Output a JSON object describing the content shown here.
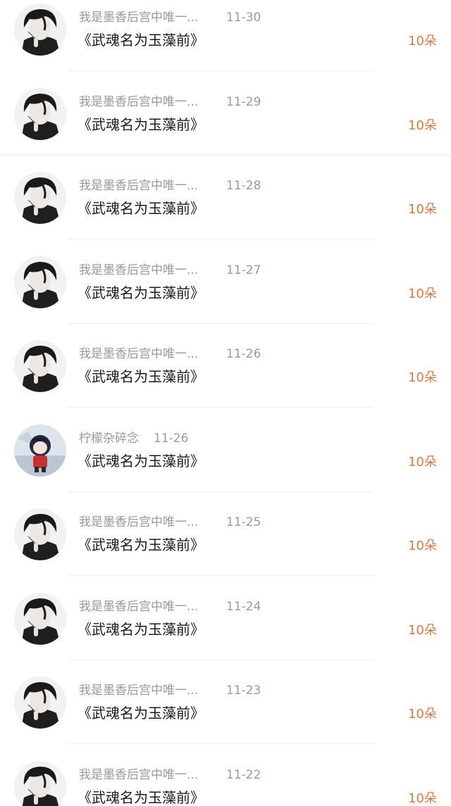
{
  "colors": {
    "name_text": "#9a9a9a",
    "title_text": "#1c1c1c",
    "amount_text": "#e0783c",
    "divider": "#f1f1f1"
  },
  "rows": [
    {
      "name": "我是墨香后宫中唯一...",
      "date": "11-30",
      "title": "《武魂名为玉藻前》",
      "amount": "10朵",
      "avatar": "ink-haired-boy"
    },
    {
      "name": "我是墨香后宫中唯一...",
      "date": "11-29",
      "title": "《武魂名为玉藻前》",
      "amount": "10朵",
      "avatar": "ink-haired-boy"
    },
    {
      "name": "我是墨香后宫中唯一...",
      "date": "11-28",
      "title": "《武魂名为玉藻前》",
      "amount": "10朵",
      "avatar": "ink-haired-boy"
    },
    {
      "name": "我是墨香后宫中唯一...",
      "date": "11-27",
      "title": "《武魂名为玉藻前》",
      "amount": "10朵",
      "avatar": "ink-haired-boy"
    },
    {
      "name": "我是墨香后宫中唯一...",
      "date": "11-26",
      "title": "《武魂名为玉藻前》",
      "amount": "10朵",
      "avatar": "ink-haired-boy"
    },
    {
      "name": "柠檬杂碎念",
      "date": "11-26",
      "title": "《武魂名为玉藻前》",
      "amount": "10朵",
      "avatar": "chibi-character"
    },
    {
      "name": "我是墨香后宫中唯一...",
      "date": "11-25",
      "title": "《武魂名为玉藻前》",
      "amount": "10朵",
      "avatar": "ink-haired-boy"
    },
    {
      "name": "我是墨香后宫中唯一...",
      "date": "11-24",
      "title": "《武魂名为玉藻前》",
      "amount": "10朵",
      "avatar": "ink-haired-boy"
    },
    {
      "name": "我是墨香后宫中唯一...",
      "date": "11-23",
      "title": "《武魂名为玉藻前》",
      "amount": "10朵",
      "avatar": "ink-haired-boy"
    },
    {
      "name": "我是墨香后宫中唯一...",
      "date": "11-22",
      "title": "《武魂名为玉藻前》",
      "amount": "10朵",
      "avatar": "ink-haired-boy"
    }
  ]
}
